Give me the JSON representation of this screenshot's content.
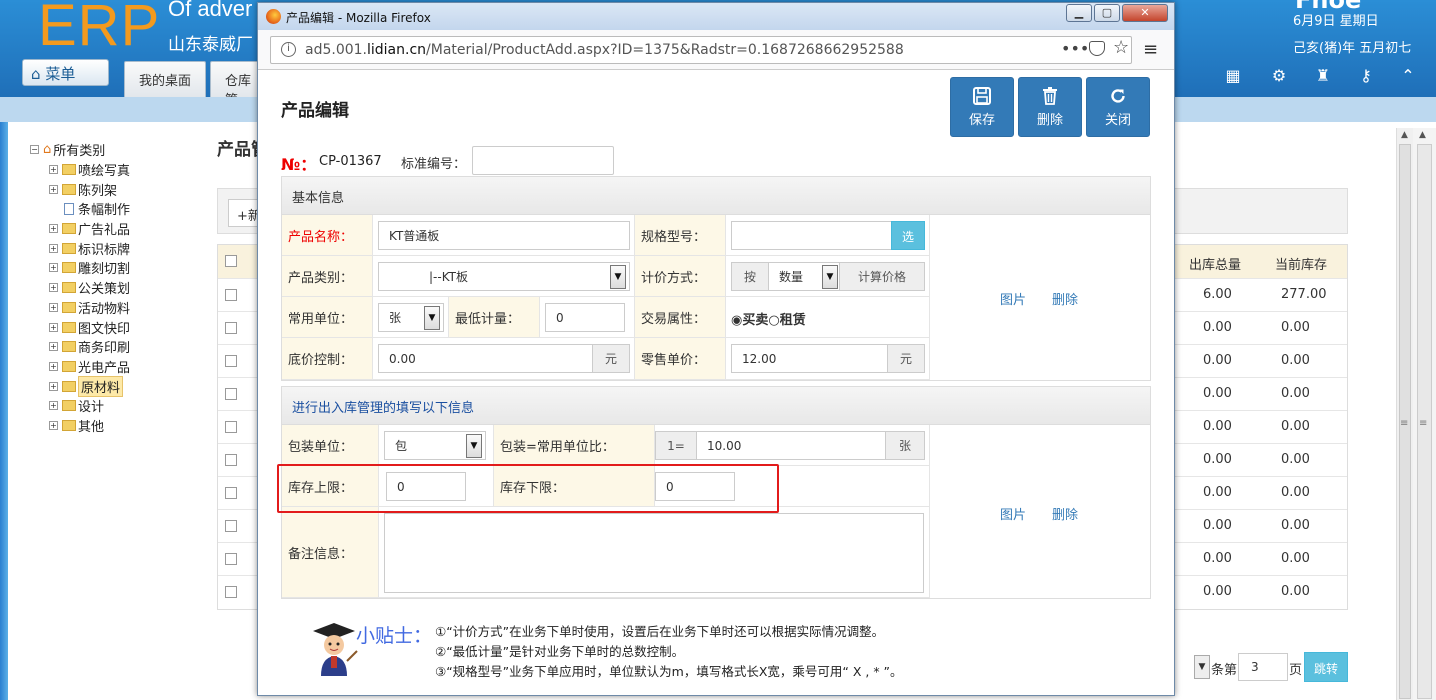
{
  "app": {
    "logo": "ERP",
    "company_en": "Of adver",
    "company_cn": "山东泰威厂",
    "menu_label": "菜单",
    "tabs": [
      "我的桌面",
      "仓库管"
    ],
    "date": "6月9日 星期日",
    "lunar": "己亥(猪)年 五月初七",
    "clipped_top": "Fhoe"
  },
  "sidebar": {
    "items": [
      {
        "label": "所有类别",
        "root": true
      },
      {
        "label": "喷绘写真"
      },
      {
        "label": "陈列架"
      },
      {
        "label": "条幅制作",
        "doc": true
      },
      {
        "label": "广告礼品"
      },
      {
        "label": "标识标牌"
      },
      {
        "label": "雕刻切割"
      },
      {
        "label": "公关策划"
      },
      {
        "label": "活动物料"
      },
      {
        "label": "图文快印"
      },
      {
        "label": "商务印刷"
      },
      {
        "label": "光电产品"
      },
      {
        "label": "原材料",
        "selected": true
      },
      {
        "label": "设计"
      },
      {
        "label": "其他"
      }
    ]
  },
  "background_page": {
    "title": "产品管",
    "new_btn": "+新",
    "col_out": "出库总量",
    "col_stock": "当前库存",
    "rows": [
      [
        "6.00",
        "277.00"
      ],
      [
        "0.00",
        "0.00"
      ],
      [
        "0.00",
        "0.00"
      ],
      [
        "0.00",
        "0.00"
      ],
      [
        "0.00",
        "0.00"
      ],
      [
        "0.00",
        "0.00"
      ],
      [
        "0.00",
        "0.00"
      ],
      [
        "0.00",
        "0.00"
      ],
      [
        "0.00",
        "0.00"
      ],
      [
        "0.00",
        "0.00"
      ]
    ],
    "pager_label": "条第",
    "page_value": "3",
    "page_unit": "页",
    "jump": "跳转"
  },
  "popup": {
    "window_title": "产品编辑 - Mozilla Firefox",
    "url_prefix": "ad5.001.",
    "url_domain": "lidian.cn",
    "url_rest": "/Material/ProductAdd.aspx?ID=1375&Radstr=0.1687268662952588",
    "page_title": "产品编辑",
    "save": "保存",
    "delete": "删除",
    "close": "关闭",
    "code_symbol": "№：",
    "code_value": "CP-01367",
    "std_label": "标准编号：",
    "basic": {
      "header": "基本信息",
      "name_label": "产品名称：",
      "name_value": "KT普通板",
      "spec_label": "规格型号：",
      "spec_btn": "选",
      "cat_label": "产品类别：",
      "cat_value": "|--KT板",
      "price_mode_label": "计价方式：",
      "price_mode_prefix": "按",
      "price_mode_value": "数量",
      "calc_btn": "计算价格",
      "unit_label": "常用单位：",
      "unit_value": "张",
      "min_label": "最低计量：",
      "min_value": "0",
      "trade_label": "交易属性：",
      "trade_buy": "买卖",
      "trade_rent": "租赁",
      "floor_label": "底价控制：",
      "floor_value": "0.00",
      "floor_unit": "元",
      "retail_label": "零售单价：",
      "retail_value": "12.00",
      "retail_unit": "元",
      "image_link": "图片",
      "delete_link": "删除"
    },
    "stock": {
      "header": "进行出入库管理的填写以下信息",
      "pack_label": "包装单位：",
      "pack_value": "包",
      "ratio_label": "包装=常用单位比：",
      "ratio_prefix": "1=",
      "ratio_value": "10.00",
      "ratio_unit": "张",
      "upper_label": "库存上限：",
      "upper_value": "0",
      "lower_label": "库存下限：",
      "lower_value": "0",
      "note_label": "备注信息：",
      "image_link": "图片",
      "delete_link": "删除"
    },
    "tips": {
      "title": "小贴士：",
      "lines": [
        "①“计价方式”在业务下单时使用，设置后在业务下单时还可以根据实际情况调整。",
        "②“最低计量”是针对业务下单时的总数控制。",
        "③“规格型号”业务下单应用时，单位默认为m，填写格式长X宽，乘号可用“ X , * ”。"
      ]
    }
  }
}
